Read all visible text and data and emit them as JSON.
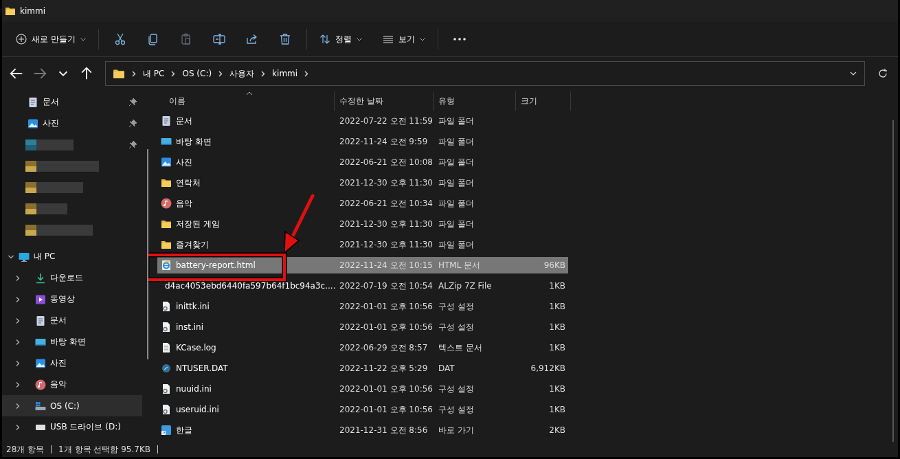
{
  "window": {
    "title": "kimmi"
  },
  "toolbar": {
    "new_label": "새로 만들기",
    "actions": [
      {
        "kind": "cut",
        "disabled": false
      },
      {
        "kind": "copy",
        "disabled": false
      },
      {
        "kind": "paste",
        "disabled": true
      },
      {
        "kind": "rename",
        "disabled": false
      },
      {
        "kind": "share",
        "disabled": false
      },
      {
        "kind": "delete",
        "disabled": false
      }
    ],
    "sort_label": "정렬",
    "view_label": "보기"
  },
  "navigation": {
    "back_disabled": false,
    "forward_disabled": true,
    "breadcrumb": [
      "내 PC",
      "OS (C:)",
      "사용자",
      "kimmi"
    ]
  },
  "sidebar": {
    "items": [
      {
        "kind": "document",
        "label": "문서",
        "pinned": true,
        "selected": false
      },
      {
        "kind": "pictures",
        "label": "사진",
        "pinned": true,
        "selected": false
      },
      {
        "kind": "redacted",
        "pinned": true
      },
      {
        "kind": "redacted",
        "pinned": false
      },
      {
        "kind": "redacted",
        "pinned": false
      },
      {
        "kind": "redacted",
        "pinned": false
      },
      {
        "kind": "redacted",
        "pinned": false
      },
      {
        "kind": "pc",
        "label": "내 PC",
        "expanded": true,
        "selected": false,
        "children": [
          {
            "kind": "download",
            "label": "다운로드",
            "expanded": false,
            "selected": false
          },
          {
            "kind": "video",
            "label": "동영상",
            "expanded": false,
            "selected": false
          },
          {
            "kind": "document",
            "label": "문서",
            "expanded": false,
            "selected": false
          },
          {
            "kind": "desktop",
            "label": "바탕 화면",
            "expanded": false,
            "selected": false
          },
          {
            "kind": "pictures",
            "label": "사진",
            "expanded": false,
            "selected": false
          },
          {
            "kind": "music",
            "label": "음악",
            "expanded": false,
            "selected": false
          },
          {
            "kind": "drive",
            "label": "OS (C:)",
            "expanded": false,
            "selected": true
          },
          {
            "kind": "usb",
            "label": "USB 드라이브 (D:)",
            "expanded": false,
            "selected": false
          }
        ]
      }
    ]
  },
  "file_list": {
    "columns": [
      {
        "label": "이름",
        "sorted": true
      },
      {
        "label": "수정한 날짜",
        "sorted": false
      },
      {
        "label": "유형",
        "sorted": false
      },
      {
        "label": "크기",
        "sorted": false
      }
    ],
    "rows": [
      {
        "kind": "document",
        "name": "문서",
        "date": "2022-07-22 오전 11:59",
        "type": "파일 폴더",
        "selected": false,
        "highlighted": false
      },
      {
        "kind": "desktop",
        "name": "바탕 화면",
        "date": "2022-11-24 오전 9:59",
        "type": "파일 폴더",
        "selected": false,
        "highlighted": false
      },
      {
        "kind": "pictures",
        "name": "사진",
        "date": "2022-06-21 오전 10:08",
        "type": "파일 폴더",
        "selected": false,
        "highlighted": false
      },
      {
        "kind": "folder",
        "name": "연락처",
        "date": "2021-12-30 오후 11:30",
        "type": "파일 폴더",
        "selected": false,
        "highlighted": false
      },
      {
        "kind": "music",
        "name": "음악",
        "date": "2022-06-21 오전 10:34",
        "type": "파일 폴더",
        "selected": false,
        "highlighted": false
      },
      {
        "kind": "folder",
        "name": "저장된 게임",
        "date": "2021-12-30 오후 11:30",
        "type": "파일 폴더",
        "selected": false,
        "highlighted": false
      },
      {
        "kind": "folder",
        "name": "즐겨찾기",
        "date": "2021-12-30 오후 11:30",
        "type": "파일 폴더",
        "selected": false,
        "highlighted": false
      },
      {
        "kind": "html",
        "name": "battery-report.html",
        "date": "2022-11-24 오전 10:15",
        "type": "HTML 문서",
        "size": "96KB",
        "selected": true,
        "highlighted": true
      },
      {
        "kind": "zip",
        "name": "d4ac4053ebd6440fa597b64f1bc94a3c....",
        "date": "2022-07-19 오전 10:54",
        "type": "ALZip 7Z File",
        "size": "1KB",
        "selected": false,
        "highlighted": false
      },
      {
        "kind": "ini",
        "name": "inittk.ini",
        "date": "2022-01-01 오후 10:56",
        "type": "구성 설정",
        "size": "1KB",
        "selected": false,
        "highlighted": false
      },
      {
        "kind": "ini",
        "name": "inst.ini",
        "date": "2022-01-01 오후 10:56",
        "type": "구성 설정",
        "size": "1KB",
        "selected": false,
        "highlighted": false
      },
      {
        "kind": "text",
        "name": "KCase.log",
        "date": "2022-06-29 오전 8:57",
        "type": "텍스트 문서",
        "size": "1KB",
        "selected": false,
        "highlighted": false
      },
      {
        "kind": "dat",
        "name": "NTUSER.DAT",
        "date": "2022-11-22 오후 5:29",
        "type": "DAT",
        "size": "6,912KB",
        "selected": false,
        "highlighted": false
      },
      {
        "kind": "ini",
        "name": "nuuid.ini",
        "date": "2022-01-01 오후 10:56",
        "type": "구성 설정",
        "size": "1KB",
        "selected": false,
        "highlighted": false
      },
      {
        "kind": "ini",
        "name": "useruid.ini",
        "date": "2022-01-01 오후 10:56",
        "type": "구성 설정",
        "size": "1KB",
        "selected": false,
        "highlighted": false
      },
      {
        "kind": "shortcut",
        "name": "한글",
        "date": "2021-12-31 오전 8:56",
        "type": "바로 가기",
        "size": "2KB",
        "selected": false,
        "highlighted": false
      }
    ]
  },
  "status_bar": [
    "28개 항목",
    "1개 항목 선택함 95.7KB"
  ]
}
